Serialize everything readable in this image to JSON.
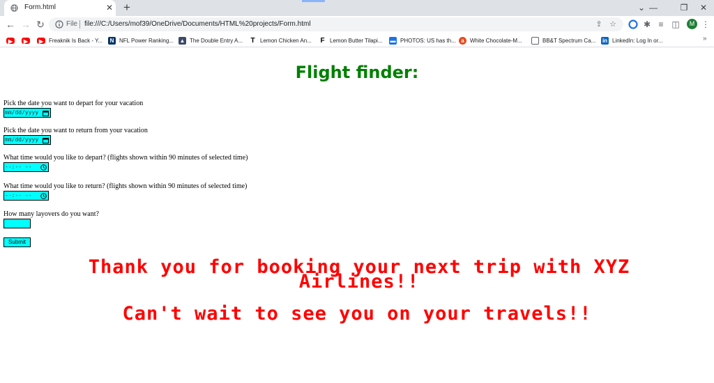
{
  "browser": {
    "tab_title": "Form.html",
    "tab_close": "✕",
    "new_tab": "+",
    "window_controls": {
      "minimize": "⌄",
      "min": "—",
      "restore": "❐",
      "close": "✕"
    },
    "file_label": "File",
    "url": "file:///C:/Users/mof39/OneDrive/Documents/HTML%20projects/Form.html",
    "profile_initial": "M",
    "bookmarks_more": "»",
    "bookmarks": [
      {
        "label": "",
        "icon": "youtube-icon",
        "color": "#ff0000"
      },
      {
        "label": "",
        "icon": "youtube-icon",
        "color": "#ff0000"
      },
      {
        "label": "Freaknik Is Back - Y...",
        "icon": "youtube-icon",
        "color": "#ff0000"
      },
      {
        "label": "NFL Power Ranking...",
        "icon": "nfl-icon",
        "color": "#013369"
      },
      {
        "label": "The Double Entry A...",
        "icon": "site-icon",
        "color": "#3b4a6b"
      },
      {
        "label": "Lemon Chicken An...",
        "icon": "t-icon",
        "color": "#000000"
      },
      {
        "label": "Lemon Butter Tilapi...",
        "icon": "f-icon",
        "color": "#000000"
      },
      {
        "label": "PHOTOS: US has th...",
        "icon": "photos-icon",
        "color": "#1a73e8"
      },
      {
        "label": "White Chocolate-M...",
        "icon": "recipe-icon",
        "color": "#e8491d"
      },
      {
        "label": "BB&T Spectrum Ca...",
        "icon": "page-icon",
        "color": "#5f6368"
      },
      {
        "label": "LinkedIn: Log In or...",
        "icon": "linkedin-icon",
        "color": "#0a66c2"
      }
    ]
  },
  "form": {
    "heading": "Flight finder:",
    "depart_date_label": "Pick the date you want to depart for your vacation",
    "depart_date_value": "mm/dd/yyyy",
    "return_date_label": "Pick the date you want to return from your vacation",
    "return_date_value": "mm/dd/yyyy",
    "depart_time_label": "What time would you like to depart? (flights shown within 90 minutes of selected time)",
    "depart_time_value": "--:-- --",
    "return_time_label": "What time would you like to return? (flights shown within 90 minutes of selected time)",
    "return_time_value": "--:-- --",
    "layovers_label": "How many layovers do you want?",
    "layovers_value": "",
    "submit_label": "Submit"
  },
  "messages": {
    "thanks": "Thank you for booking your next trip with XYZ Airlines!!",
    "see_you": "Can't wait to see you on your travels!!"
  },
  "colors": {
    "heading": "#008000",
    "field_bg": "#00ffff",
    "message": "#ff0000"
  }
}
